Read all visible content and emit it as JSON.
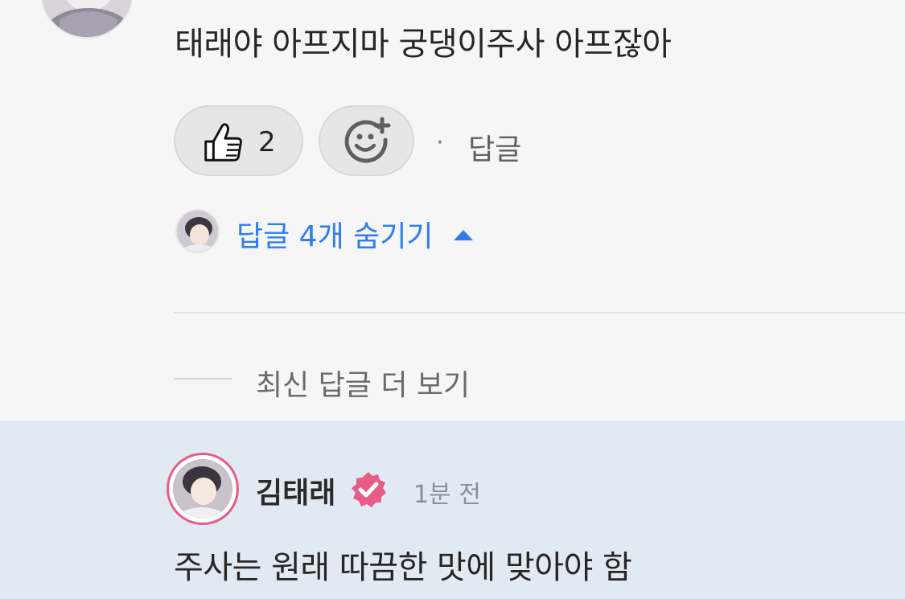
{
  "comment": {
    "text": "태래야 아프지마 궁댕이주사 아프잖아",
    "like_count": "2",
    "separator": "·",
    "reply_label": "답글"
  },
  "replies_toggle": {
    "label": "답글 4개 숨기기"
  },
  "more_replies": {
    "label": "최신 답글 더 보기"
  },
  "reply": {
    "author": "김태래",
    "timestamp": "1분 전",
    "text": "주사는 원래 따끔한 맛에 맞아야 함"
  },
  "colors": {
    "background": "#f6f6f6",
    "accent_blue": "#2f7cf0",
    "verified_pink": "#e85c88",
    "highlight_bg": "#e1e9f3"
  },
  "icons": {
    "like": "thumbs-up-icon",
    "reaction": "add-reaction-icon",
    "toggle": "caret-up-icon",
    "verified": "verified-badge-icon"
  }
}
